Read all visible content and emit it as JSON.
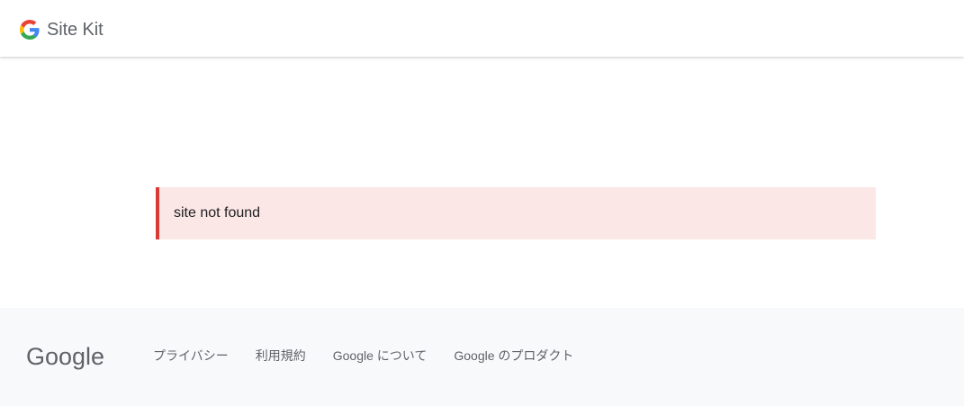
{
  "header": {
    "brand_name": "Site Kit",
    "logo_icon": "google-g-icon"
  },
  "notice": {
    "message": "site not found",
    "type": "error",
    "accent_color": "#d93a36",
    "background_color": "#fbe7e6"
  },
  "footer": {
    "logo_text": "Google",
    "links": [
      {
        "label": "プライバシー"
      },
      {
        "label": "利用規約"
      },
      {
        "label": "Google について"
      },
      {
        "label": "Google のプロダクト"
      }
    ],
    "background_color": "#f8f9fa"
  },
  "colors": {
    "google_blue": "#4285F4",
    "google_red": "#EA4335",
    "google_yellow": "#FBBC05",
    "google_green": "#34A853",
    "text_secondary": "#5f6368"
  }
}
